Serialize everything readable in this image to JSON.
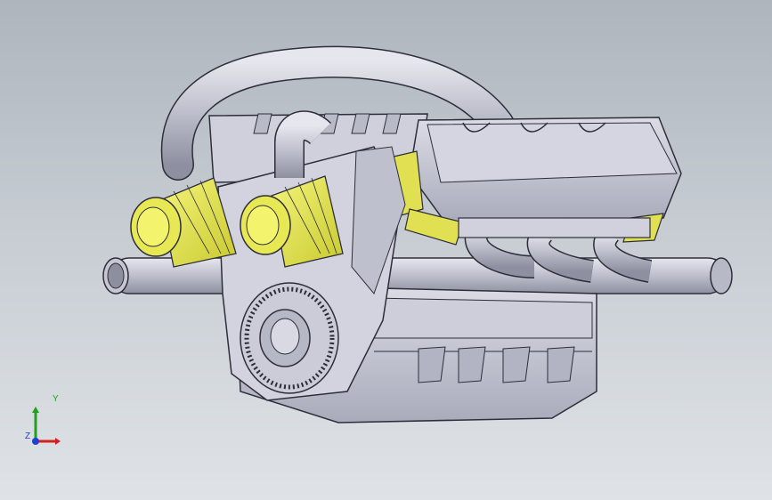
{
  "viewport": {
    "background_top": "#aeb5bd",
    "background_bottom": "#dfe3e7"
  },
  "model": {
    "icon": "v8-engine-model",
    "body_color": "#c9cad7",
    "edge_color": "#3a3a46",
    "highlight_color": "#e0e052"
  },
  "triad": {
    "y_label": "Y",
    "z_label": "Z",
    "x_color": "#d02020",
    "y_color": "#20a020",
    "z_color": "#2040d0"
  }
}
